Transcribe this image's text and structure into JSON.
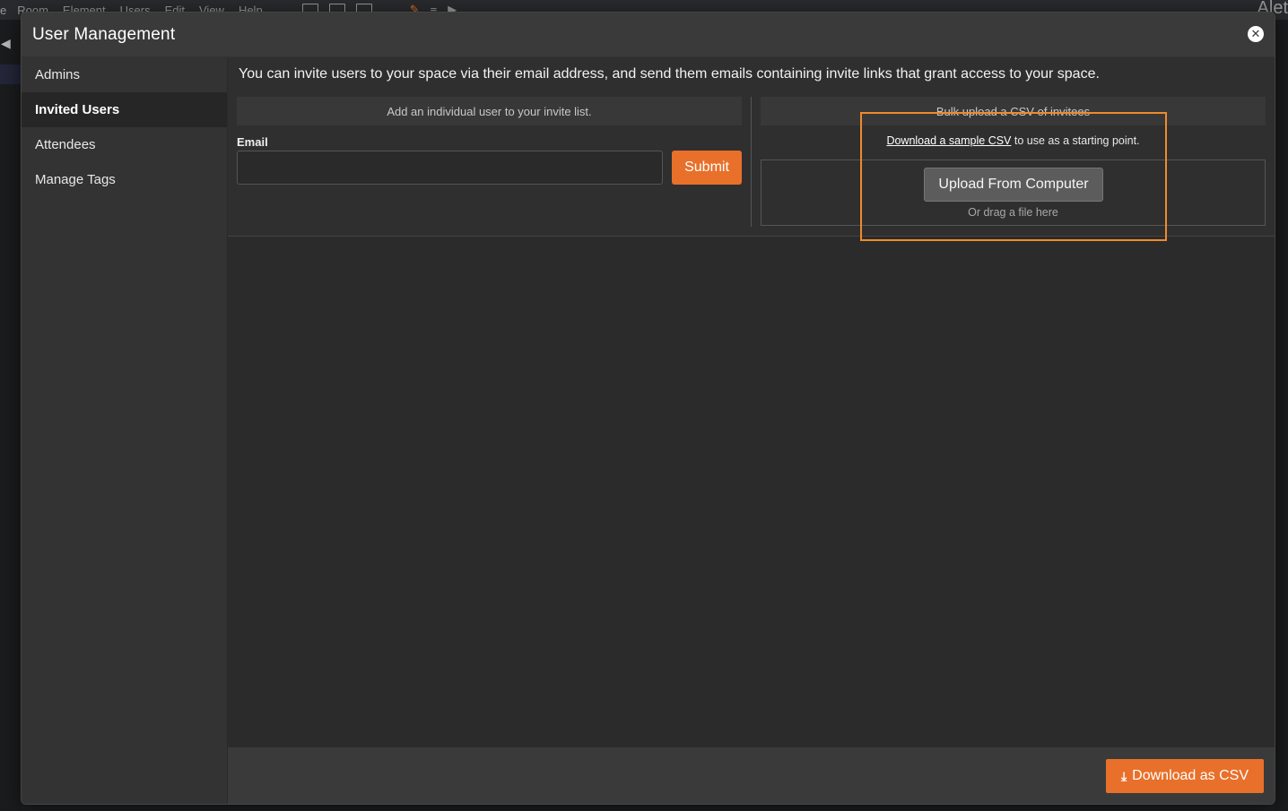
{
  "app": {
    "menu": [
      "e",
      "Room",
      "Element",
      "Users",
      "Edit",
      "View",
      "Help"
    ],
    "brand": "Alet"
  },
  "modal": {
    "title": "User Management",
    "close_icon": "close-icon"
  },
  "sidebar": {
    "items": [
      {
        "label": "Admins",
        "active": false
      },
      {
        "label": "Invited Users",
        "active": true
      },
      {
        "label": "Attendees",
        "active": false
      },
      {
        "label": "Manage Tags",
        "active": false
      }
    ]
  },
  "main": {
    "intro": "You can invite users to your space via their email address, and send them emails containing invite links that grant access to your space.",
    "individual": {
      "header": "Add an individual user to your invite list.",
      "email_label": "Email",
      "email_value": "",
      "submit_label": "Submit"
    },
    "bulk": {
      "header": "Bulk upload a CSV of invitees",
      "sample_link": "Download a sample CSV",
      "sample_suffix": "to use as a starting point.",
      "upload_label": "Upload From Computer",
      "drag_text": "Or drag a file here"
    }
  },
  "footer": {
    "download_label": "Download as CSV",
    "download_icon": "download-icon"
  },
  "colors": {
    "accent": "#e8702a",
    "highlight": "#f08a2c"
  }
}
